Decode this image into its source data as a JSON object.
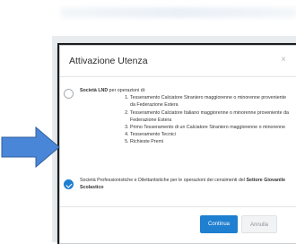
{
  "dialog": {
    "title": "Attivazione Utenza",
    "close_icon": "close-icon"
  },
  "options": [
    {
      "selected": false,
      "lead_bold": "Società LND",
      "lead_rest": " per operazioni di:",
      "items": [
        "Tesseramento Calciatore Straniero maggiorenne o minorenne proveniente da Federazione Estera",
        "Tesseramento Calciatore Italiano maggiorenne o minorenne proveniente da Federazione Estera",
        "Primo Tesseramento di un Calciatore Straniero maggiorenne o minorenne",
        "Tesseramento Tecnici",
        "Richieste Premi"
      ]
    },
    {
      "selected": true,
      "text": "Società Professionistiche e Dilettantistiche per le operazioni dei censimenti del ",
      "text_bold": "Settore Giovanile Scolastico"
    }
  ],
  "buttons": {
    "continue": "Continua",
    "cancel": "Annulla"
  },
  "colors": {
    "primary": "#1f7fd0",
    "arrow": "#4a86d8"
  }
}
